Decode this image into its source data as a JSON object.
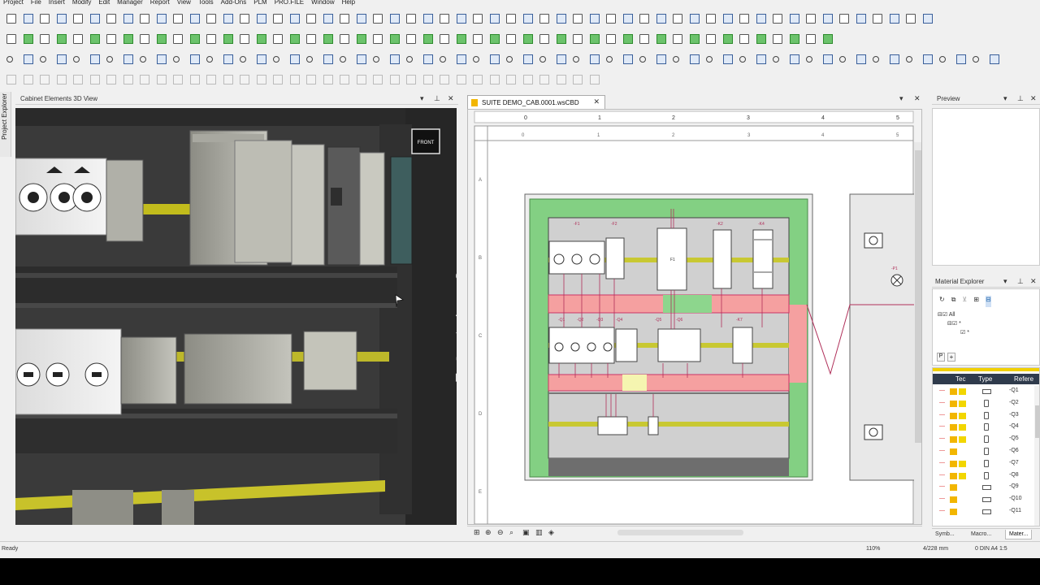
{
  "menu": [
    "Project",
    "File",
    "Insert",
    "Modify",
    "Edit",
    "Manager",
    "Report",
    "View",
    "Tools",
    "Add-Ons",
    "PLM",
    "PRO.FILE",
    "Window",
    "Help"
  ],
  "side_tab": {
    "label": "Project Explorer"
  },
  "view3d": {
    "title": "Cabinet Elements 3D View",
    "cube_label": "FRONT"
  },
  "doc": {
    "tab_title": "SUITE DEMO_CAB.0001.wsCBD"
  },
  "ruler": {
    "top_marks": [
      "0",
      "1",
      "2",
      "3",
      "4",
      "5"
    ],
    "inner_marks": [
      "0",
      "1",
      "2",
      "3",
      "4",
      "5"
    ],
    "left_marks": [
      "A",
      "B",
      "C",
      "D",
      "E"
    ]
  },
  "cabinet": {
    "top_tags": [
      "-F1",
      "-F2",
      "-K2",
      "-K4"
    ],
    "mid_tags": [
      "-Q1",
      "-Q2",
      "-Q3",
      "-Q4",
      "-Q5",
      "-Q6",
      "-K7",
      "-P1"
    ],
    "f1_label": "F1",
    "door_tag": "-P1"
  },
  "preview": {
    "title": "Preview"
  },
  "material": {
    "title": "Material Explorer",
    "tree_items": [
      "All",
      "*",
      "*"
    ],
    "filter_label": "P",
    "columns": [
      "Tec",
      "Type",
      "Refere"
    ],
    "rows": [
      {
        "ref": "-Q1",
        "type": "rect",
        "c": [
          "#f2b600",
          "#f2d600"
        ]
      },
      {
        "ref": "-Q2",
        "type": "sym",
        "c": [
          "#f2b600",
          "#f2d600"
        ]
      },
      {
        "ref": "-Q3",
        "type": "sym",
        "c": [
          "#f2b600",
          "#f2d600"
        ]
      },
      {
        "ref": "-Q4",
        "type": "sym",
        "c": [
          "#f2b600",
          "#f2d600"
        ]
      },
      {
        "ref": "-Q5",
        "type": "sym",
        "c": [
          "#f2b600",
          "#f2d600"
        ]
      },
      {
        "ref": "-Q6",
        "type": "sym",
        "c": [
          "#f2b600",
          ""
        ]
      },
      {
        "ref": "-Q7",
        "type": "sym",
        "c": [
          "#f2b600",
          "#f2d600"
        ]
      },
      {
        "ref": "-Q8",
        "type": "sym",
        "c": [
          "#f2b600",
          "#f2d600"
        ]
      },
      {
        "ref": "-Q9",
        "type": "rect",
        "c": [
          "#f2b600",
          ""
        ]
      },
      {
        "ref": "-Q10",
        "type": "rect",
        "c": [
          "#f2b600",
          ""
        ]
      },
      {
        "ref": "-Q11",
        "type": "rect",
        "c": [
          "#f2b600",
          ""
        ]
      }
    ],
    "bottom_tabs": [
      "Symb...",
      "Macro...",
      "Mater..."
    ]
  },
  "status": {
    "left": "Ready",
    "zoom": "110%",
    "coords": "4/228 mm",
    "sheet": "0  DIN A4  1:5"
  },
  "colors": {
    "green_duct": "#83d083",
    "red_duct": "#f5a0a0",
    "din_rail": "#c8c832",
    "wire": "#b0305a"
  }
}
